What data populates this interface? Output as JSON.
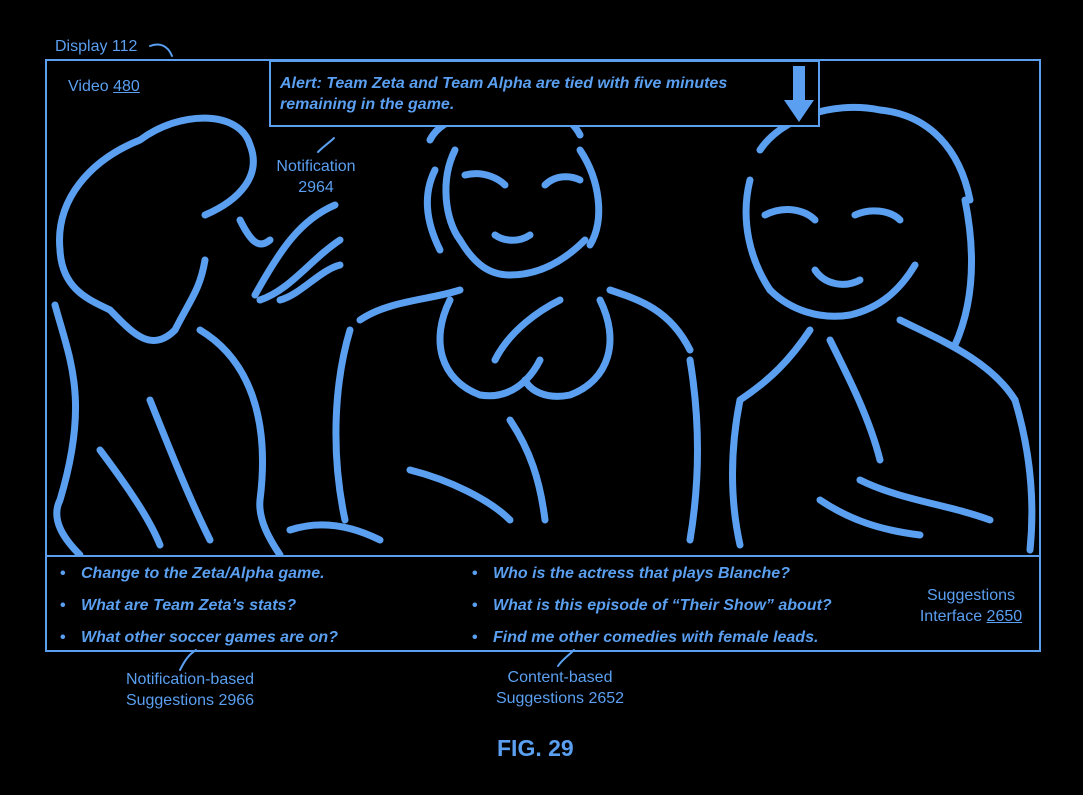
{
  "display_label": "Display 112",
  "video_label": {
    "text": "Video ",
    "ref": "480"
  },
  "alert": {
    "line1": "Alert: Team Zeta and Team Alpha are tied with five minutes",
    "line2": "remaining in the game."
  },
  "notification_label": {
    "line1": "Notification",
    "line2": "2964"
  },
  "notification_suggestions": [
    "Change to the Zeta/Alpha game.",
    "What are Team Zeta’s stats?",
    "What other soccer games are on?"
  ],
  "content_suggestions": [
    "Who is the actress that plays Blanche?",
    "What is this episode of “Their Show” about?",
    "Find me other comedies with female leads."
  ],
  "suggestions_interface_label": {
    "line1": "Suggestions",
    "line2": "Interface ",
    "ref": "2650"
  },
  "notification_based_label": {
    "line1": "Notification-based",
    "line2": "Suggestions 2966"
  },
  "content_based_label": {
    "line1": "Content-based",
    "line2": "Suggestions 2652"
  },
  "figure_caption": "FIG. 29",
  "colors": {
    "line": "#5a9ff0",
    "background": "#000000"
  },
  "bullet_glyph": "•"
}
